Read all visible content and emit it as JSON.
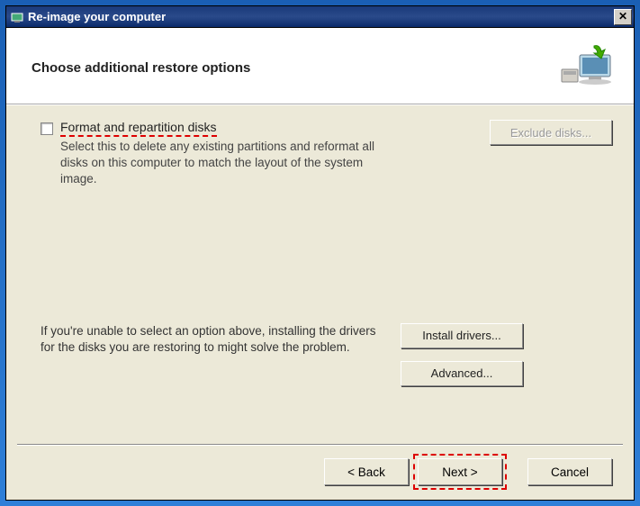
{
  "title": "Re-image your computer",
  "header": "Choose additional restore options",
  "option": {
    "label": "Format and repartition disks",
    "description": "Select this to delete any existing partitions and reformat all disks on this computer to match the layout of the system image."
  },
  "excludeBtn": "Exclude disks...",
  "midText": "If you're unable to select an option above, installing the drivers for the disks you are restoring to might solve the problem.",
  "installBtn": "Install drivers...",
  "advancedBtn": "Advanced...",
  "nav": {
    "back": "< Back",
    "next": "Next >",
    "cancel": "Cancel"
  },
  "closeGlyph": "✕"
}
